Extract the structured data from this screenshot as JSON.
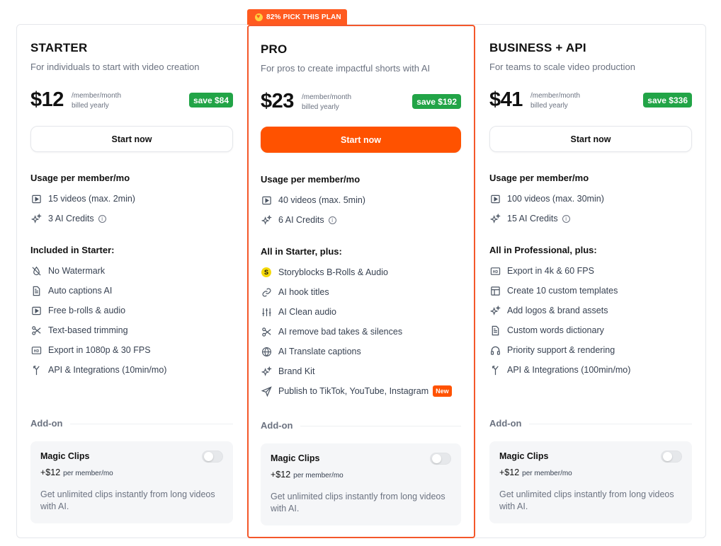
{
  "top_badge": "82% PICK THIS PLAN",
  "plans": [
    {
      "name": "STARTER",
      "description": "For individuals to start with video creation",
      "price": "$12",
      "price_unit": "/member/month",
      "billing": "billed yearly",
      "save": "save $84",
      "cta": "Start now",
      "usage_title": "Usage per member/mo",
      "usage": [
        "15 videos (max. 2min)",
        "3 AI Credits"
      ],
      "included_title": "Included in Starter:",
      "features": [
        "No Watermark",
        "Auto captions AI",
        "Free b-rolls & audio",
        "Text-based trimming",
        "Export in 1080p & 30 FPS",
        "API & Integrations (10min/mo)"
      ],
      "feature_icons": [
        "no-watermark-icon",
        "document-icon",
        "play-icon",
        "scissors-icon",
        "hd-icon",
        "api-icon"
      ],
      "addon_label": "Add-on",
      "addon_title": "Magic Clips",
      "addon_price": "+$12",
      "addon_price_unit": "per member/mo",
      "addon_desc": "Get unlimited clips instantly from long videos with AI."
    },
    {
      "name": "PRO",
      "description": "For pros to create impactful shorts with AI",
      "price": "$23",
      "price_unit": "/member/month",
      "billing": "billed yearly",
      "save": "save $192",
      "cta": "Start now",
      "usage_title": "Usage per member/mo",
      "usage": [
        "40 videos (max. 5min)",
        "6 AI Credits"
      ],
      "included_title": "All in Starter, plus:",
      "features": [
        "Storyblocks B-Rolls & Audio",
        "AI hook titles",
        "AI Clean audio",
        "AI remove bad takes & silences",
        "AI Translate captions",
        "Brand Kit",
        "Publish to TikTok, YouTube, Instagram"
      ],
      "feature_icons": [
        "storyblocks-icon",
        "link-icon",
        "sliders-icon",
        "scissors-icon",
        "globe-icon",
        "sparkle-icon",
        "send-icon"
      ],
      "new_badge": "New",
      "addon_label": "Add-on",
      "addon_title": "Magic Clips",
      "addon_price": "+$12",
      "addon_price_unit": "per member/mo",
      "addon_desc": "Get unlimited clips instantly from long videos with AI."
    },
    {
      "name": "BUSINESS + API",
      "description": "For teams to scale video production",
      "price": "$41",
      "price_unit": "/member/month",
      "billing": "billed yearly",
      "save": "save $336",
      "cta": "Start now",
      "usage_title": "Usage per member/mo",
      "usage": [
        "100 videos (max. 30min)",
        "15 AI Credits"
      ],
      "included_title": "All in Professional, plus:",
      "features": [
        "Export in 4k & 60 FPS",
        "Create 10 custom templates",
        "Add logos & brand assets",
        "Custom words dictionary",
        "Priority support & rendering",
        "API & Integrations (100min/mo)"
      ],
      "feature_icons": [
        "hd-icon",
        "template-icon",
        "sparkle-icon",
        "document-icon",
        "headphones-icon",
        "api-icon"
      ],
      "addon_label": "Add-on",
      "addon_title": "Magic Clips",
      "addon_price": "+$12",
      "addon_price_unit": "per member/mo",
      "addon_desc": "Get unlimited clips instantly from long videos with AI."
    }
  ],
  "colors": {
    "accent": "#ff5200",
    "save_green": "#22a447",
    "pro_border": "#f4572a"
  }
}
